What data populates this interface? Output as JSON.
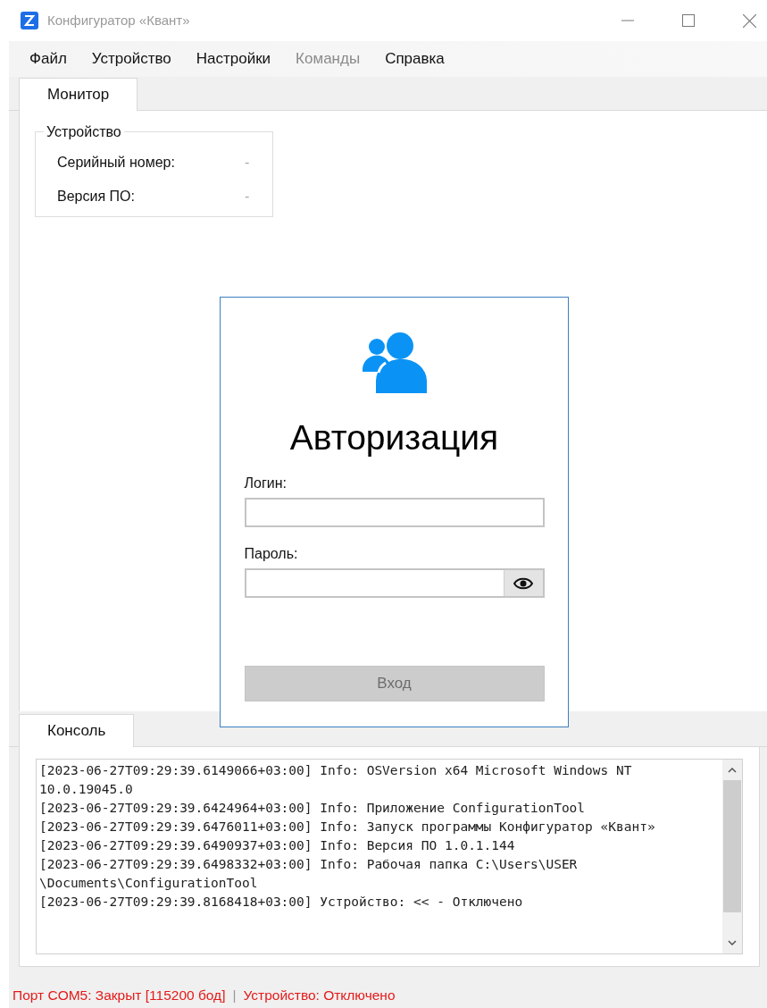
{
  "window": {
    "title": "Конфигуратор «Квант»"
  },
  "menu": [
    {
      "label": "Файл",
      "disabled": false
    },
    {
      "label": "Устройство",
      "disabled": false
    },
    {
      "label": "Настройки",
      "disabled": false
    },
    {
      "label": "Команды",
      "disabled": true
    },
    {
      "label": "Справка",
      "disabled": false
    }
  ],
  "tabs": [
    {
      "label": "Монитор",
      "selected": true
    }
  ],
  "device_group": {
    "title": "Устройство",
    "rows": [
      {
        "label": "Серийный номер:",
        "value": "-"
      },
      {
        "label": "Версия ПО:",
        "value": "-"
      }
    ]
  },
  "login_dialog": {
    "title": "Авторизация",
    "login_label": "Логин:",
    "password_label": "Пароль:",
    "submit": {
      "label": "Вход",
      "disabled": true
    }
  },
  "console_tabs": [
    {
      "label": "Консоль",
      "selected": true
    }
  ],
  "console_lines": [
    "[2023-06-27T09:29:39.6149066+03:00] Info: OSVersion x64 Microsoft Windows NT 10.0.19045.0",
    "[2023-06-27T09:29:39.6424964+03:00] Info: Приложение ConfigurationTool",
    "[2023-06-27T09:29:39.6476011+03:00] Info: Запуск программы Конфигуратор «Квант»",
    "[2023-06-27T09:29:39.6490937+03:00] Info: Версия ПО 1.0.1.144",
    "[2023-06-27T09:29:39.6498332+03:00] Info: Рабочая папка C:\\Users\\USER \\Documents\\ConfigurationTool",
    "[2023-06-27T09:29:39.8168418+03:00] Устройство: << - Отключено"
  ],
  "status_bar": {
    "port": "Порт COM5: Закрыт [115200 бод]",
    "separator": "|",
    "device": "Устройство: Отключено"
  }
}
